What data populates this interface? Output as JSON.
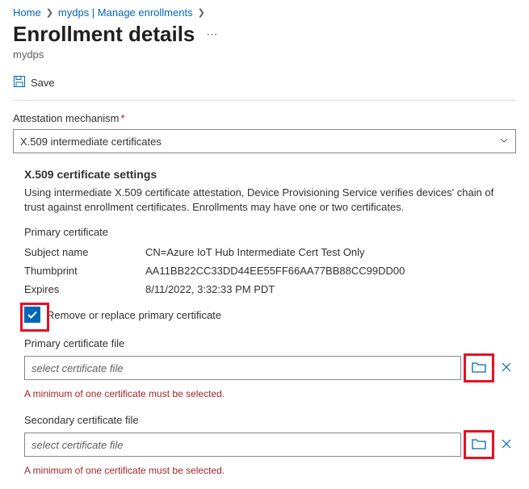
{
  "breadcrumb": {
    "home": "Home",
    "item2": "mydps | Manage enrollments"
  },
  "page": {
    "title": "Enrollment details",
    "subtitle": "mydps"
  },
  "toolbar": {
    "save_label": "Save"
  },
  "attestation": {
    "label": "Attestation mechanism",
    "value": "X.509 intermediate certificates"
  },
  "x509": {
    "heading": "X.509 certificate settings",
    "desc": "Using intermediate X.509 certificate attestation, Device Provisioning Service verifies devices' chain of trust against enrollment certificates. Enrollments may have one or two certificates.",
    "primary_heading": "Primary certificate",
    "subject_name_label": "Subject name",
    "subject_name_value": "CN=Azure IoT Hub Intermediate Cert Test Only",
    "thumbprint_label": "Thumbprint",
    "thumbprint_value": "AA11BB22CC33DD44EE55FF66AA77BB88CC99DD00",
    "expires_label": "Expires",
    "expires_value": "8/11/2022, 3:32:33 PM PDT",
    "remove_replace_label": "Remove or replace primary certificate",
    "primary_file_label": "Primary certificate file",
    "secondary_file_label": "Secondary certificate file",
    "file_placeholder": "select certificate file",
    "error_msg": "A minimum of one certificate must be selected."
  }
}
